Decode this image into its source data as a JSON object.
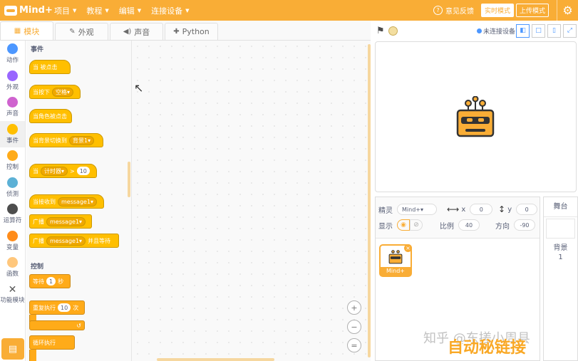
{
  "app": {
    "logo_text": "Mind+"
  },
  "menu": [
    {
      "label": "项目"
    },
    {
      "label": "教程"
    },
    {
      "label": "编辑"
    },
    {
      "label": "连接设备"
    }
  ],
  "topright": {
    "feedback": "意见反馈",
    "realtime": "实时模式",
    "upload": "上传模式"
  },
  "tabs": [
    {
      "label": "模块",
      "icon": "▦"
    },
    {
      "label": "外观",
      "icon": "✎"
    },
    {
      "label": "声音",
      "icon": "◀)"
    },
    {
      "label": "Python",
      "icon": "✚"
    }
  ],
  "categories": [
    {
      "label": "动作",
      "color": "#4c97ff"
    },
    {
      "label": "外观",
      "color": "#9966ff"
    },
    {
      "label": "声音",
      "color": "#cf63cf"
    },
    {
      "label": "事件",
      "color": "#ffbf00"
    },
    {
      "label": "控制",
      "color": "#ffab19"
    },
    {
      "label": "侦测",
      "color": "#5cb1d6"
    },
    {
      "label": "运算符",
      "color": "#59c059"
    },
    {
      "label": "变量",
      "color": "#ff8c1a"
    },
    {
      "label": "函数",
      "color": "#ffc77c"
    },
    {
      "label": "功能模块",
      "color": ""
    }
  ],
  "palette": {
    "events_title": "事件",
    "control_title": "控制",
    "b_flag_clicked": "当  被点击",
    "b_key_pressed": "当按下",
    "b_key_value": "空格",
    "b_sprite_clicked": "当角色被点击",
    "b_backdrop_switch": "当背景切换到",
    "b_backdrop_value": "背景1",
    "b_when": "当",
    "b_timer": "计时器",
    "b_gt": ">",
    "b_timer_value": "10",
    "b_receive": "当接收到",
    "b_msg": "message1",
    "b_broadcast": "广播",
    "b_broadcast_wait": "广播",
    "b_and_wait": "并且等待",
    "b_wait": "等待",
    "b_wait_value": "1",
    "b_seconds": "秒",
    "b_repeat": "重复执行",
    "b_repeat_value": "10",
    "b_times": "次",
    "b_forever": "循环执行"
  },
  "stage": {
    "connection": "未连接设备"
  },
  "sprite": {
    "label_sprite": "精灵",
    "sprite_name": "Mind+",
    "label_x": "x",
    "x": "0",
    "label_y": "y",
    "y": "0",
    "label_show": "显示",
    "label_size": "比例",
    "size": "40",
    "label_dir": "方向",
    "dir": "-90",
    "card_name": "Mind+"
  },
  "backdrop": {
    "title": "舞台",
    "label": "背景",
    "count": "1"
  },
  "watermark": {
    "text1": "知乎 @东搓小周县",
    "text2": "自动秘链接"
  }
}
